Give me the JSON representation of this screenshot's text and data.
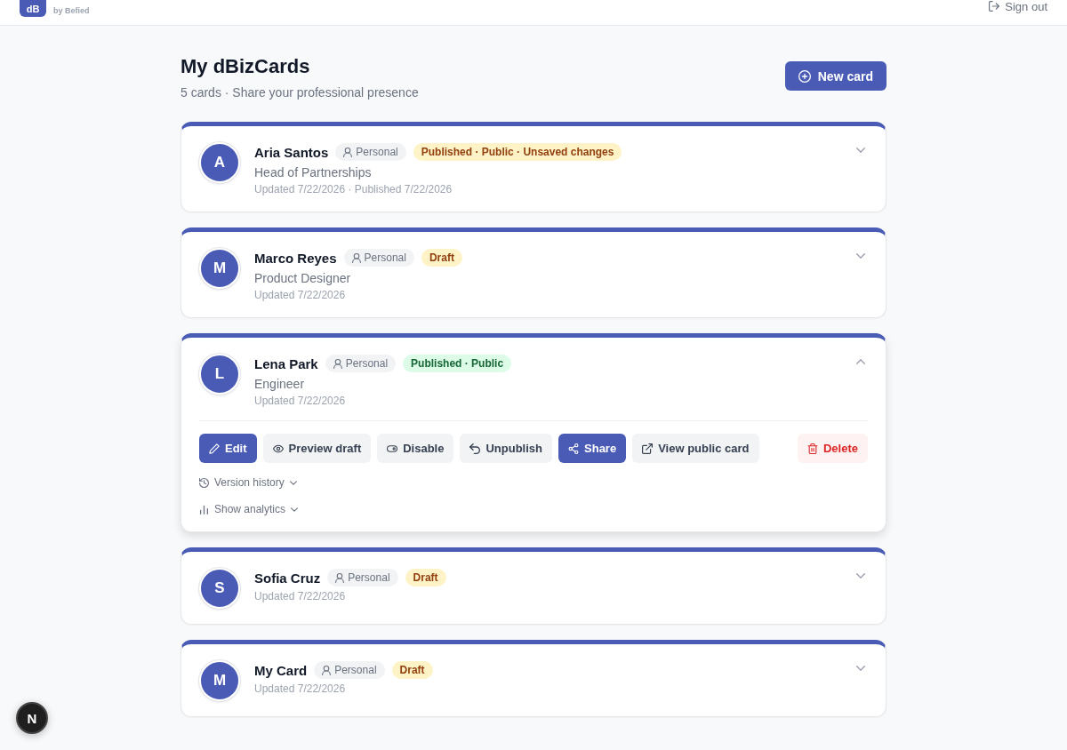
{
  "header": {
    "logo": "dB",
    "tagline": "by Befied",
    "sign_out": "Sign out"
  },
  "page": {
    "title": "My dBizCards",
    "subtitle": "5 cards · Share your professional presence",
    "new_card": "New card"
  },
  "cards": [
    {
      "initial": "A",
      "name": "Aria Santos",
      "type": "Personal",
      "status": {
        "label": "Published · Public · Unsaved changes",
        "kind": "pending"
      },
      "role": "Head of Partnerships",
      "meta": "Updated 7/22/2026 · Published 7/22/2026",
      "expanded": false
    },
    {
      "initial": "M",
      "name": "Marco Reyes",
      "type": "Personal",
      "status": {
        "label": "Draft",
        "kind": "pending"
      },
      "role": "Product Designer",
      "meta": "Updated 7/22/2026",
      "expanded": false
    },
    {
      "initial": "L",
      "name": "Lena Park",
      "type": "Personal",
      "status": {
        "label": "Published · Public",
        "kind": "live"
      },
      "role": "Engineer",
      "meta": "Updated 7/22/2026",
      "expanded": true,
      "actions": [
        {
          "label": "Edit",
          "kind": "primary"
        },
        {
          "label": "Preview draft",
          "kind": "secondary"
        },
        {
          "label": "Disable",
          "kind": "secondary"
        },
        {
          "label": "Unpublish",
          "kind": "secondary"
        },
        {
          "label": "Share",
          "kind": "primary"
        },
        {
          "label": "View public card",
          "kind": "secondary"
        },
        {
          "label": "Delete",
          "kind": "danger"
        }
      ],
      "sections": [
        {
          "label": "Version history",
          "expanded": false
        },
        {
          "label": "Show analytics",
          "expanded": false
        }
      ]
    },
    {
      "initial": "S",
      "name": "Sofia Cruz",
      "type": "Personal",
      "status": {
        "label": "Draft",
        "kind": "pending"
      },
      "meta": "Updated 7/22/2026",
      "expanded": false
    },
    {
      "initial": "M",
      "name": "My Card",
      "type": "Personal",
      "status": {
        "label": "Draft",
        "kind": "pending"
      },
      "meta": "Updated 7/22/2026",
      "expanded": false
    }
  ],
  "dev_badge": "N"
}
